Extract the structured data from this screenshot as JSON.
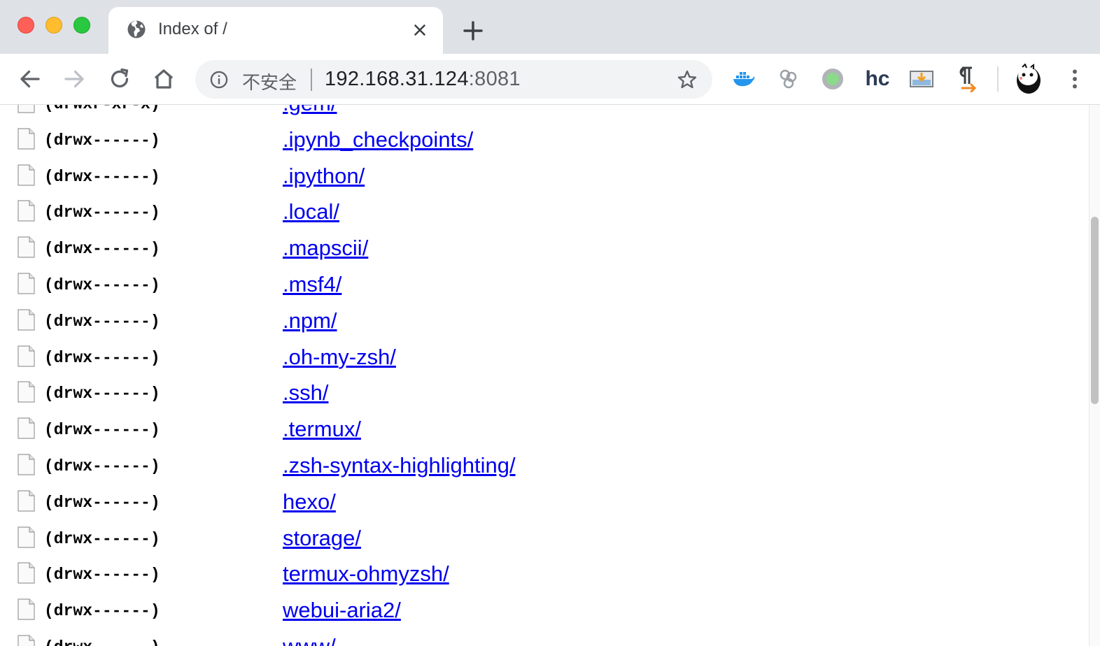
{
  "browser": {
    "tab": {
      "title": "Index of /"
    },
    "address_bar": {
      "security_label": "不安全",
      "host": "192.168.31.124",
      "port": ":8081"
    },
    "extensions": [
      {
        "name": "docker-whale-icon"
      },
      {
        "name": "cluster-icon"
      },
      {
        "name": "status-dot-icon"
      },
      {
        "name": "hc-text-icon",
        "label": "hc"
      },
      {
        "name": "image-download-icon"
      },
      {
        "name": "pilcrow-arrow-icon"
      },
      {
        "name": "profile-avatar-icon"
      }
    ]
  },
  "listing": {
    "entries": [
      {
        "perm": "(drwxr-xr-x)",
        "name": ".gem/"
      },
      {
        "perm": "(drwx------)",
        "name": ".ipynb_checkpoints/"
      },
      {
        "perm": "(drwx------)",
        "name": ".ipython/"
      },
      {
        "perm": "(drwx------)",
        "name": ".local/"
      },
      {
        "perm": "(drwx------)",
        "name": ".mapscii/"
      },
      {
        "perm": "(drwx------)",
        "name": ".msf4/"
      },
      {
        "perm": "(drwx------)",
        "name": ".npm/"
      },
      {
        "perm": "(drwx------)",
        "name": ".oh-my-zsh/"
      },
      {
        "perm": "(drwx------)",
        "name": ".ssh/"
      },
      {
        "perm": "(drwx------)",
        "name": ".termux/"
      },
      {
        "perm": "(drwx------)",
        "name": ".zsh-syntax-highlighting/"
      },
      {
        "perm": "(drwx------)",
        "name": "hexo/"
      },
      {
        "perm": "(drwx------)",
        "name": "storage/"
      },
      {
        "perm": "(drwx------)",
        "name": "termux-ohmyzsh/"
      },
      {
        "perm": "(drwx------)",
        "name": "webui-aria2/"
      },
      {
        "perm": "(drwx------)",
        "name": "www/"
      }
    ]
  },
  "colors": {
    "link": "#0000ee",
    "tabstrip_bg": "#dee1e6",
    "omnibox_bg": "#f1f3f4"
  }
}
